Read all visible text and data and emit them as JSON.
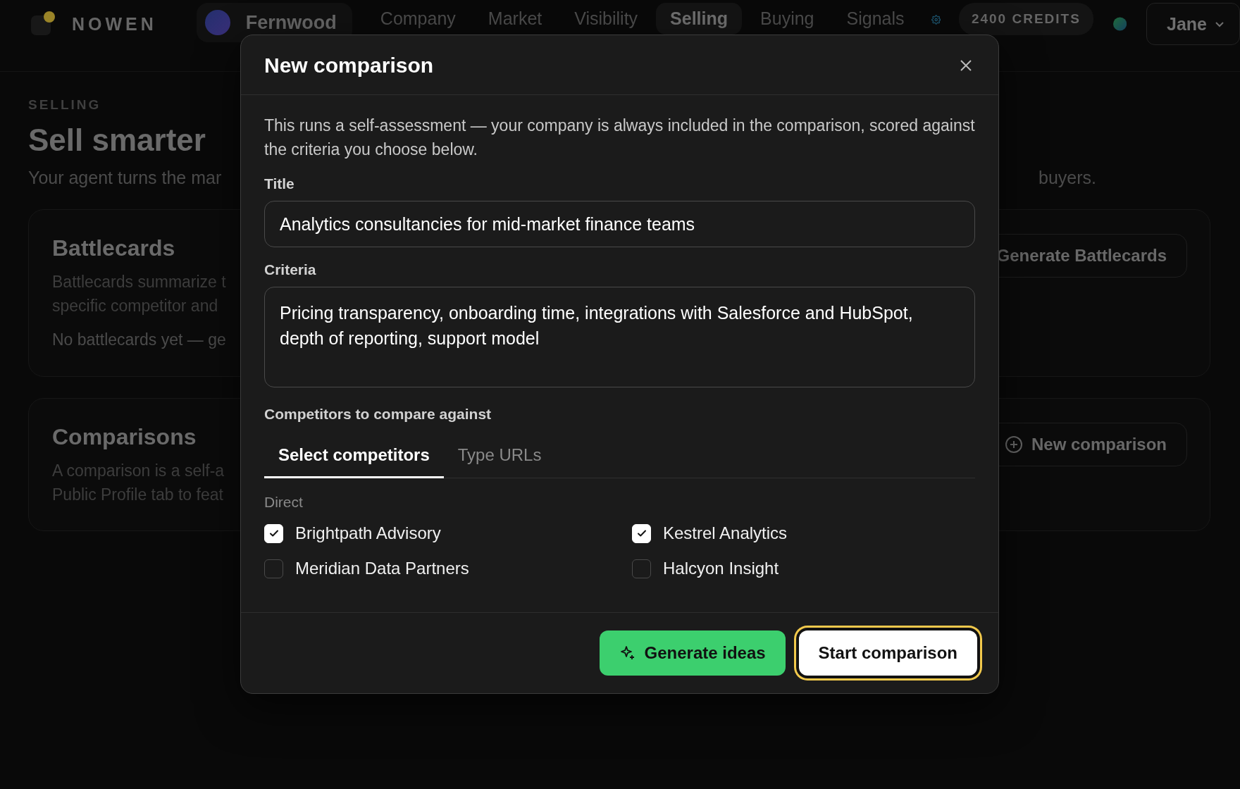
{
  "nav": {
    "brand": "NOWEN",
    "workspace": "Fernwood",
    "items": [
      {
        "label": "Company",
        "selected": false
      },
      {
        "label": "Market",
        "selected": false
      },
      {
        "label": "Visibility",
        "selected": false
      },
      {
        "label": "Selling",
        "selected": true
      },
      {
        "label": "Buying",
        "selected": false
      },
      {
        "label": "Signals",
        "selected": false
      }
    ],
    "credits": "2400 CREDITS",
    "user": "Jane"
  },
  "page": {
    "eyebrow": "SELLING",
    "title": "Sell smarter",
    "intro_start": "Your agent turns the mar",
    "intro_end": "buyers.",
    "cards": [
      {
        "title": "Battlecards",
        "lines": [
          "Battlecards summarize t",
          "specific competitor and"
        ],
        "note": "No battlecards yet — ge",
        "action": {
          "label": "Generate Battlecards"
        }
      },
      {
        "title": "Comparisons",
        "lines": [
          "A comparison is a self-a",
          "Public Profile tab to feat"
        ],
        "action": {
          "label": "New comparison"
        }
      }
    ]
  },
  "modal": {
    "title": "New comparison",
    "description": "This runs a self-assessment — your company is always included in the comparison, scored against the criteria you choose below.",
    "fields": [
      {
        "label": "Title",
        "kind": "input",
        "value": "Analytics consultancies for mid-market finance teams"
      },
      {
        "label": "Criteria",
        "kind": "textarea",
        "value": "Pricing transparency, onboarding time, integrations with Salesforce and HubSpot, depth of reporting, support model"
      }
    ],
    "competitors": {
      "label": "Competitors to compare against",
      "tabs": [
        {
          "label": "Select competitors",
          "selected": true
        },
        {
          "label": "Type URLs",
          "selected": false
        }
      ],
      "group": "Direct",
      "options": [
        {
          "label": "Brightpath Advisory",
          "checked": true
        },
        {
          "label": "Kestrel Analytics",
          "checked": true
        },
        {
          "label": "Meridian Data Partners",
          "checked": false
        },
        {
          "label": "Halcyon Insight",
          "checked": false
        }
      ]
    },
    "buttons": [
      {
        "label": "Generate ideas",
        "kind": "primary",
        "focused": false
      },
      {
        "label": "Start comparison",
        "kind": "secondary",
        "focused": true
      }
    ]
  }
}
